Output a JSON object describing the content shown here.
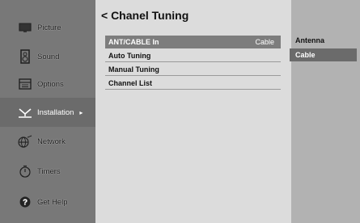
{
  "sidebar": {
    "items": [
      {
        "label": "Picture",
        "icon": "picture-icon"
      },
      {
        "label": "Sound",
        "icon": "speaker-icon"
      },
      {
        "label": "Options",
        "icon": "options-icon"
      },
      {
        "label": "Installation",
        "icon": "installation-icon",
        "selected": true
      },
      {
        "label": "Network",
        "icon": "network-icon"
      },
      {
        "label": "Timers",
        "icon": "timer-icon"
      },
      {
        "label": "Get Help",
        "icon": "help-icon"
      }
    ],
    "selected_arrow": "▸"
  },
  "main": {
    "title": "< Chanel Tuning",
    "rows": [
      {
        "label": "ANT/CABLE In",
        "value": "Cable"
      },
      {
        "label": "Auto Tuning",
        "value": ""
      },
      {
        "label": "Manual Tuning",
        "value": ""
      },
      {
        "label": "Channel List",
        "value": ""
      }
    ]
  },
  "dropdown": {
    "options": [
      "Antenna",
      "Cable"
    ],
    "selected": "Cable"
  }
}
